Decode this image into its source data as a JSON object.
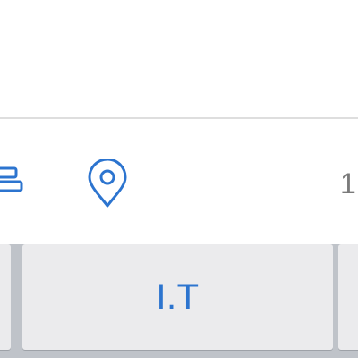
{
  "toolbar": {
    "icons": {
      "tag": "tag-icon",
      "location": "location-pin-icon"
    },
    "count_text": "1"
  },
  "keyboard": {
    "main_key_label": "I.T"
  },
  "colors": {
    "accent": "#2c74cf",
    "divider": "#dedede",
    "keyboard_bg": "#bfc3c9",
    "key_bg": "#ebebed",
    "muted_text": "#7a7a7a"
  }
}
